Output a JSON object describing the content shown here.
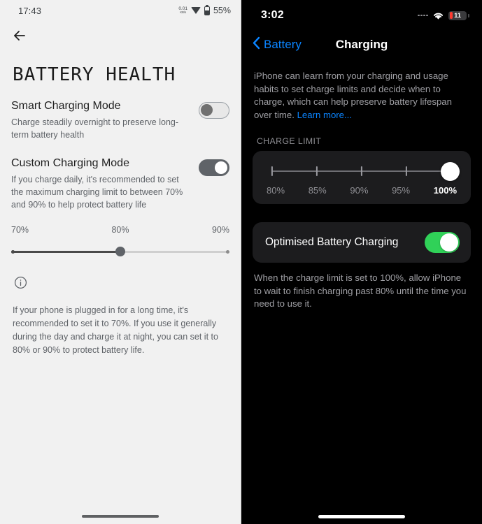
{
  "android": {
    "status_bar": {
      "clock": "17:43",
      "net_speed_value": "0.01",
      "net_speed_unit": "KB/s",
      "battery_percent": "55%"
    },
    "page_title": "BATTERY HEALTH",
    "rows": [
      {
        "title": "Smart Charging Mode",
        "subtitle": "Charge steadily overnight to preserve long-term battery health",
        "toggle_state": "off"
      },
      {
        "title": "Custom Charging Mode",
        "subtitle": "If you charge daily, it's recommended to set the maximum charging limit to between 70% and 90% to help protect battery life",
        "toggle_state": "on"
      }
    ],
    "slider": {
      "min_label": "70%",
      "mid_label": "80%",
      "max_label": "90%",
      "current_value": "80%"
    },
    "footnote": "If your phone is plugged in for a long time, it's recommended to set it to 70%. If you use it generally during the day and charge it at night, you can set it to 80% or 90% to protect battery life."
  },
  "ios": {
    "status_bar": {
      "clock": "3:02",
      "battery_percent": "11"
    },
    "nav": {
      "back_label": "Battery",
      "title": "Charging"
    },
    "description": "iPhone can learn from your charging and usage habits to set charge limits and decide when to charge, which can help preserve battery lifespan over time. ",
    "learn_more_label": "Learn more...",
    "section_header": "CHARGE LIMIT",
    "charge_limit_slider": {
      "ticks": [
        "80%",
        "85%",
        "90%",
        "95%",
        "100%"
      ],
      "selected_value": "100%"
    },
    "optimised_row": {
      "label": "Optimised Battery Charging",
      "toggle_state": "on",
      "accent_color": "#30d158"
    },
    "optimised_footnote": "When the charge limit is set to 100%, allow iPhone to wait to finish charging past 80% until the time you need to use it."
  }
}
